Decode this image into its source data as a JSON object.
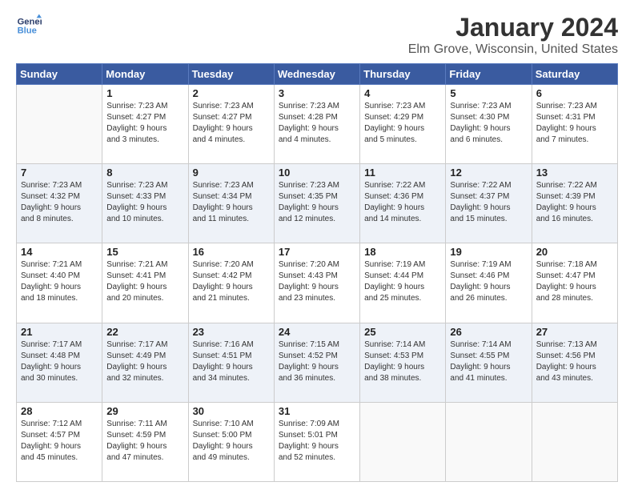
{
  "logo": {
    "line1": "General",
    "line2": "Blue"
  },
  "title": "January 2024",
  "subtitle": "Elm Grove, Wisconsin, United States",
  "header_days": [
    "Sunday",
    "Monday",
    "Tuesday",
    "Wednesday",
    "Thursday",
    "Friday",
    "Saturday"
  ],
  "weeks": [
    [
      {
        "day": "",
        "info": ""
      },
      {
        "day": "1",
        "info": "Sunrise: 7:23 AM\nSunset: 4:27 PM\nDaylight: 9 hours\nand 3 minutes."
      },
      {
        "day": "2",
        "info": "Sunrise: 7:23 AM\nSunset: 4:27 PM\nDaylight: 9 hours\nand 4 minutes."
      },
      {
        "day": "3",
        "info": "Sunrise: 7:23 AM\nSunset: 4:28 PM\nDaylight: 9 hours\nand 4 minutes."
      },
      {
        "day": "4",
        "info": "Sunrise: 7:23 AM\nSunset: 4:29 PM\nDaylight: 9 hours\nand 5 minutes."
      },
      {
        "day": "5",
        "info": "Sunrise: 7:23 AM\nSunset: 4:30 PM\nDaylight: 9 hours\nand 6 minutes."
      },
      {
        "day": "6",
        "info": "Sunrise: 7:23 AM\nSunset: 4:31 PM\nDaylight: 9 hours\nand 7 minutes."
      }
    ],
    [
      {
        "day": "7",
        "info": "Sunrise: 7:23 AM\nSunset: 4:32 PM\nDaylight: 9 hours\nand 8 minutes."
      },
      {
        "day": "8",
        "info": "Sunrise: 7:23 AM\nSunset: 4:33 PM\nDaylight: 9 hours\nand 10 minutes."
      },
      {
        "day": "9",
        "info": "Sunrise: 7:23 AM\nSunset: 4:34 PM\nDaylight: 9 hours\nand 11 minutes."
      },
      {
        "day": "10",
        "info": "Sunrise: 7:23 AM\nSunset: 4:35 PM\nDaylight: 9 hours\nand 12 minutes."
      },
      {
        "day": "11",
        "info": "Sunrise: 7:22 AM\nSunset: 4:36 PM\nDaylight: 9 hours\nand 14 minutes."
      },
      {
        "day": "12",
        "info": "Sunrise: 7:22 AM\nSunset: 4:37 PM\nDaylight: 9 hours\nand 15 minutes."
      },
      {
        "day": "13",
        "info": "Sunrise: 7:22 AM\nSunset: 4:39 PM\nDaylight: 9 hours\nand 16 minutes."
      }
    ],
    [
      {
        "day": "14",
        "info": "Sunrise: 7:21 AM\nSunset: 4:40 PM\nDaylight: 9 hours\nand 18 minutes."
      },
      {
        "day": "15",
        "info": "Sunrise: 7:21 AM\nSunset: 4:41 PM\nDaylight: 9 hours\nand 20 minutes."
      },
      {
        "day": "16",
        "info": "Sunrise: 7:20 AM\nSunset: 4:42 PM\nDaylight: 9 hours\nand 21 minutes."
      },
      {
        "day": "17",
        "info": "Sunrise: 7:20 AM\nSunset: 4:43 PM\nDaylight: 9 hours\nand 23 minutes."
      },
      {
        "day": "18",
        "info": "Sunrise: 7:19 AM\nSunset: 4:44 PM\nDaylight: 9 hours\nand 25 minutes."
      },
      {
        "day": "19",
        "info": "Sunrise: 7:19 AM\nSunset: 4:46 PM\nDaylight: 9 hours\nand 26 minutes."
      },
      {
        "day": "20",
        "info": "Sunrise: 7:18 AM\nSunset: 4:47 PM\nDaylight: 9 hours\nand 28 minutes."
      }
    ],
    [
      {
        "day": "21",
        "info": "Sunrise: 7:17 AM\nSunset: 4:48 PM\nDaylight: 9 hours\nand 30 minutes."
      },
      {
        "day": "22",
        "info": "Sunrise: 7:17 AM\nSunset: 4:49 PM\nDaylight: 9 hours\nand 32 minutes."
      },
      {
        "day": "23",
        "info": "Sunrise: 7:16 AM\nSunset: 4:51 PM\nDaylight: 9 hours\nand 34 minutes."
      },
      {
        "day": "24",
        "info": "Sunrise: 7:15 AM\nSunset: 4:52 PM\nDaylight: 9 hours\nand 36 minutes."
      },
      {
        "day": "25",
        "info": "Sunrise: 7:14 AM\nSunset: 4:53 PM\nDaylight: 9 hours\nand 38 minutes."
      },
      {
        "day": "26",
        "info": "Sunrise: 7:14 AM\nSunset: 4:55 PM\nDaylight: 9 hours\nand 41 minutes."
      },
      {
        "day": "27",
        "info": "Sunrise: 7:13 AM\nSunset: 4:56 PM\nDaylight: 9 hours\nand 43 minutes."
      }
    ],
    [
      {
        "day": "28",
        "info": "Sunrise: 7:12 AM\nSunset: 4:57 PM\nDaylight: 9 hours\nand 45 minutes."
      },
      {
        "day": "29",
        "info": "Sunrise: 7:11 AM\nSunset: 4:59 PM\nDaylight: 9 hours\nand 47 minutes."
      },
      {
        "day": "30",
        "info": "Sunrise: 7:10 AM\nSunset: 5:00 PM\nDaylight: 9 hours\nand 49 minutes."
      },
      {
        "day": "31",
        "info": "Sunrise: 7:09 AM\nSunset: 5:01 PM\nDaylight: 9 hours\nand 52 minutes."
      },
      {
        "day": "",
        "info": ""
      },
      {
        "day": "",
        "info": ""
      },
      {
        "day": "",
        "info": ""
      }
    ]
  ]
}
